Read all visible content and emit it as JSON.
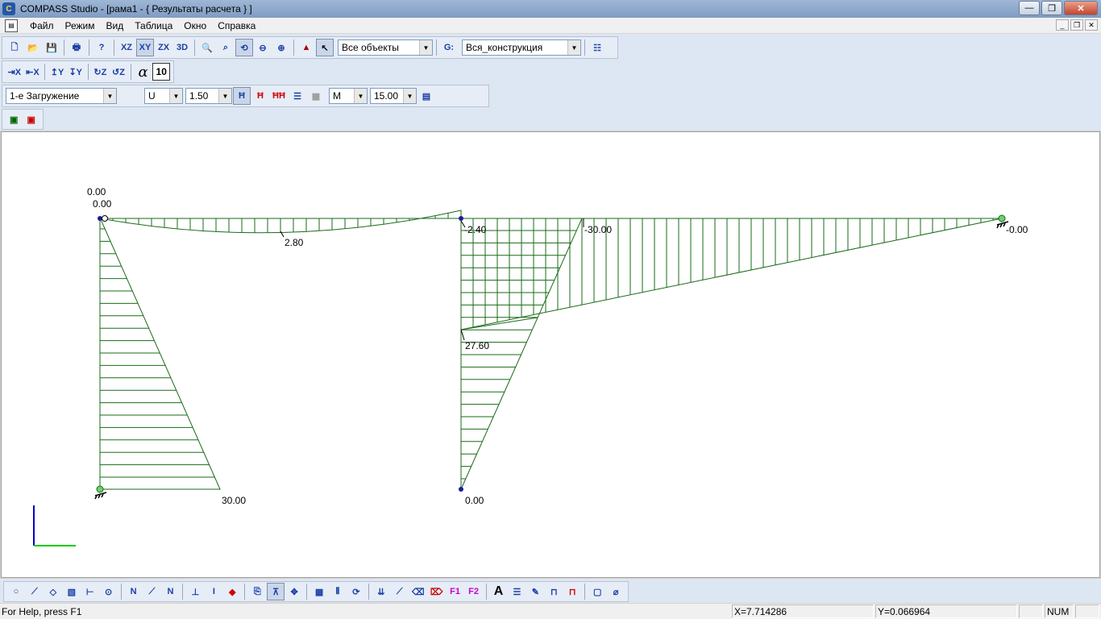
{
  "window": {
    "title": "COMPASS  Studio - [рама1 - { Результаты расчета } ]",
    "minimize": "—",
    "maximize": "❐",
    "close": "✕"
  },
  "menu": [
    "Файл",
    "Режим",
    "Вид",
    "Таблица",
    "Окно",
    "Справка"
  ],
  "toolbar": {
    "object_filter": "Все объекты",
    "construction_filter": "Вся_конструкция",
    "alpha_symbol": "α",
    "alpha_value": "10",
    "load_case": "1-е Загружение",
    "component": "U",
    "scale": "1.50",
    "diagram": "M",
    "diagram_scale": "15.00"
  },
  "diagram_labels": {
    "top_left_1": "0.00",
    "top_left_2": "0.00",
    "beam_mid": "2.80",
    "middle_node": "-2.40",
    "right_beam_node": "-30.00",
    "right_end": "-0.00",
    "middle_col": "27.60",
    "left_col_bottom": "30.00",
    "middle_col_bottom": "0.00"
  },
  "colors": {
    "diagram_line": "#1a6b1a",
    "axis_y": "#0000cc",
    "axis_x": "#00cc00"
  },
  "status": {
    "help": "For Help, press F1",
    "x": "X=7.714286",
    "y": "Y=0.066964",
    "num": "NUM"
  }
}
